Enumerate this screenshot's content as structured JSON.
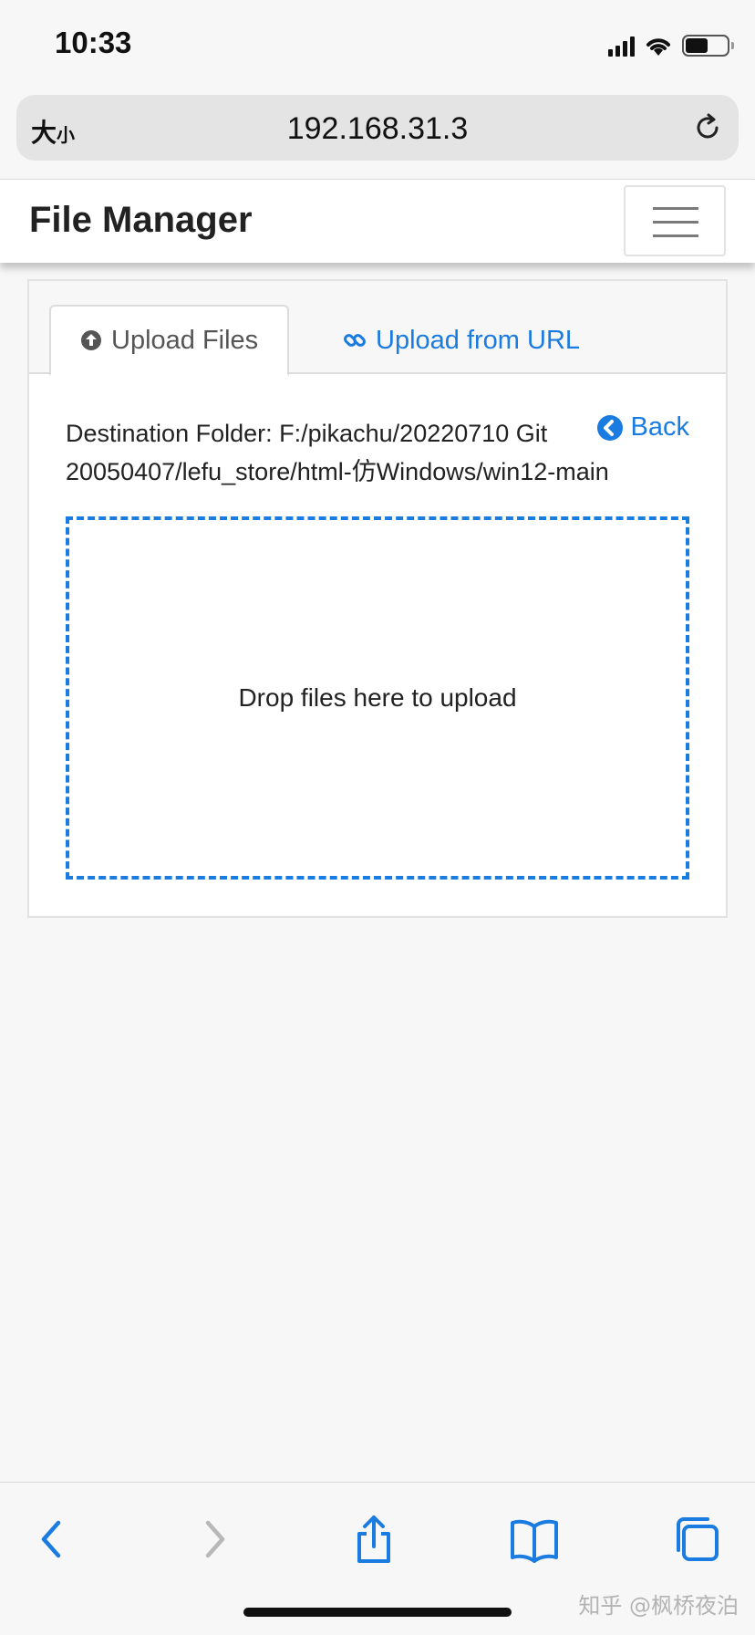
{
  "status_bar": {
    "time": "10:33"
  },
  "browser": {
    "text_size_label": "大",
    "text_size_small": "小",
    "url": "192.168.31.3"
  },
  "navbar": {
    "brand": "File Manager"
  },
  "tabs": [
    {
      "label": "Upload Files",
      "active": true,
      "icon": "arrow-circle-up-icon"
    },
    {
      "label": "Upload from URL",
      "active": false,
      "icon": "link-icon"
    }
  ],
  "upload": {
    "destination_text": "Destination Folder: F:/pikachu/20220710 Git 20050407/lefu_store/html-仿Windows/win12-main",
    "back_label": "Back",
    "dropzone_text": "Drop files here to upload"
  },
  "watermark": "知乎 @枫桥夜泊",
  "colors": {
    "accent": "#1a7be0",
    "page_bg": "#f7f7f7",
    "card_bg": "#ffffff"
  }
}
